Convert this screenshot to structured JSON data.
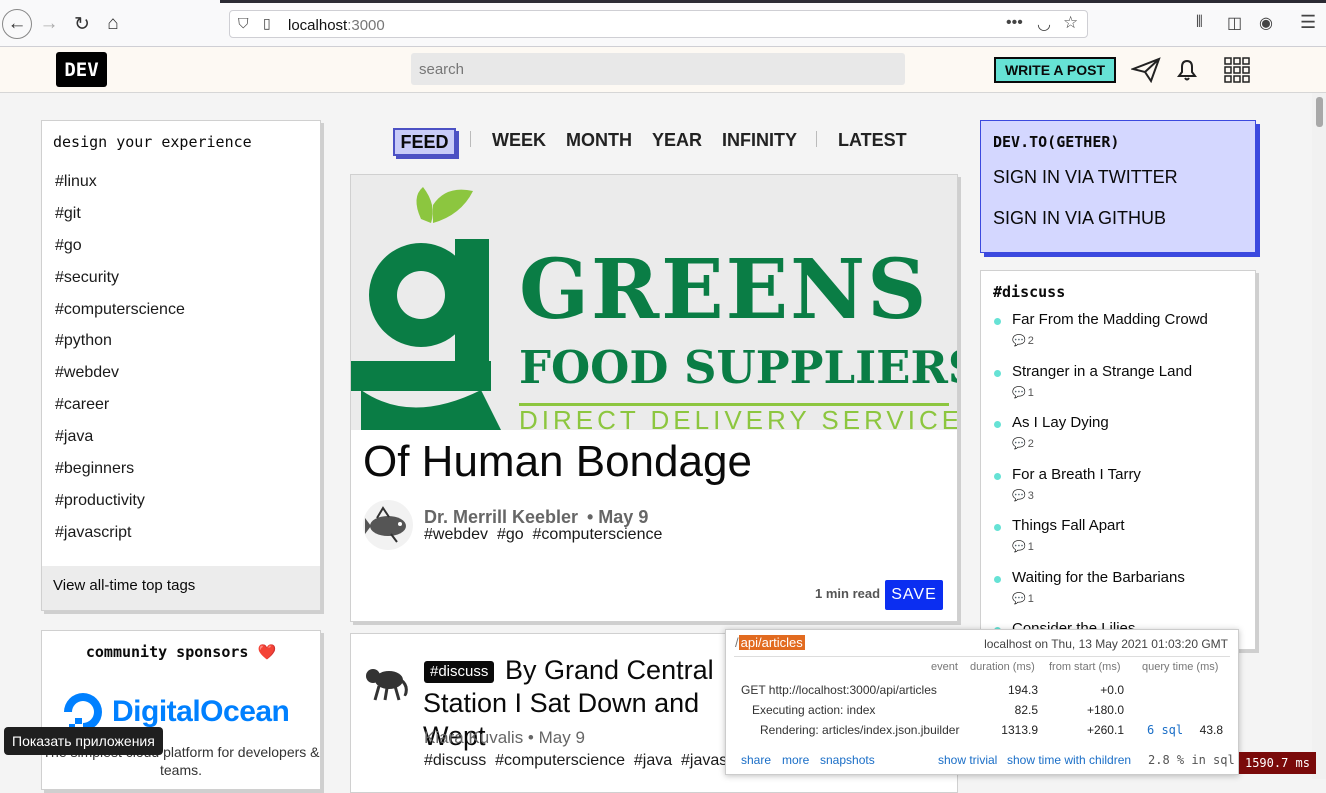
{
  "browser": {
    "url_host": "localhost",
    "url_port": ":3000"
  },
  "header": {
    "logo": "DEV",
    "search_placeholder": "search",
    "write_button": "WRITE A POST"
  },
  "sidebar_left": {
    "heading": "design your experience",
    "tags": [
      "#linux",
      "#git",
      "#go",
      "#security",
      "#computerscience",
      "#python",
      "#webdev",
      "#career",
      "#java",
      "#beginners",
      "#productivity",
      "#javascript"
    ],
    "view_all": "View all-time top tags",
    "sponsors_title": "community sponsors ❤️",
    "sponsor_name": "DigitalOcean",
    "sponsor_desc": "The simplest cloud platform for developers & teams."
  },
  "tooltip": "Показать приложения",
  "feed_nav": {
    "items": [
      "FEED",
      "WEEK",
      "MONTH",
      "YEAR",
      "INFINITY",
      "LATEST"
    ]
  },
  "article1": {
    "cover_line1": "GREENS",
    "cover_line2": "FOOD SUPPLIERS",
    "cover_line3": "DIRECT DELIVERY SERVICE",
    "title": "Of Human Bondage",
    "author": "Dr. Merrill Keebler",
    "date": "• May 9",
    "tags": "#webdev  #go  #computerscience",
    "read_time": "1 min read",
    "save": "SAVE"
  },
  "article2": {
    "badge": "#discuss",
    "title": "By Grand Central Station I Sat Down and Wept",
    "author_date": "Kiara Kuvalis • May 9",
    "tags": "#discuss  #computerscience  #java  #javascript"
  },
  "sidebar_right": {
    "heading": "DEV.TO(GETHER)",
    "twitter": "SIGN IN VIA TWITTER",
    "github": "SIGN IN VIA GITHUB",
    "discuss_heading": "#discuss",
    "discussions": [
      {
        "title": "Far From the Madding Crowd",
        "count": "2"
      },
      {
        "title": "Stranger in a Strange Land",
        "count": "1"
      },
      {
        "title": "As I Lay Dying",
        "count": "2"
      },
      {
        "title": "For a Breath I Tarry",
        "count": "3"
      },
      {
        "title": "Things Fall Apart",
        "count": "1"
      },
      {
        "title": "Waiting for the Barbarians",
        "count": "1"
      },
      {
        "title": "Consider the Lilies",
        "count": ""
      }
    ]
  },
  "profiler": {
    "path_prefix": "/",
    "path": "api/articles",
    "meta": "localhost on Thu, 13 May 2021 01:03:20 GMT",
    "columns": [
      "event",
      "duration (ms)",
      "from start (ms)",
      "query time (ms)"
    ],
    "rows": [
      {
        "event": "GET http://localhost:3000/api/articles",
        "duration": "194.3",
        "start": "+0.0",
        "sql": "",
        "qtime": ""
      },
      {
        "event": "Executing action: index",
        "duration": "82.5",
        "start": "+180.0",
        "sql": "",
        "qtime": ""
      },
      {
        "event": "Rendering: articles/index.json.jbuilder",
        "duration": "1313.9",
        "start": "+260.1",
        "sql": "6 sql",
        "qtime": "43.8"
      }
    ],
    "links": [
      "share",
      "more",
      "snapshots"
    ],
    "show_trivial": "show trivial",
    "show_children": "show time with children",
    "pct_sql": "2.8 % in sql",
    "total_ms": "1590.7 ms"
  }
}
